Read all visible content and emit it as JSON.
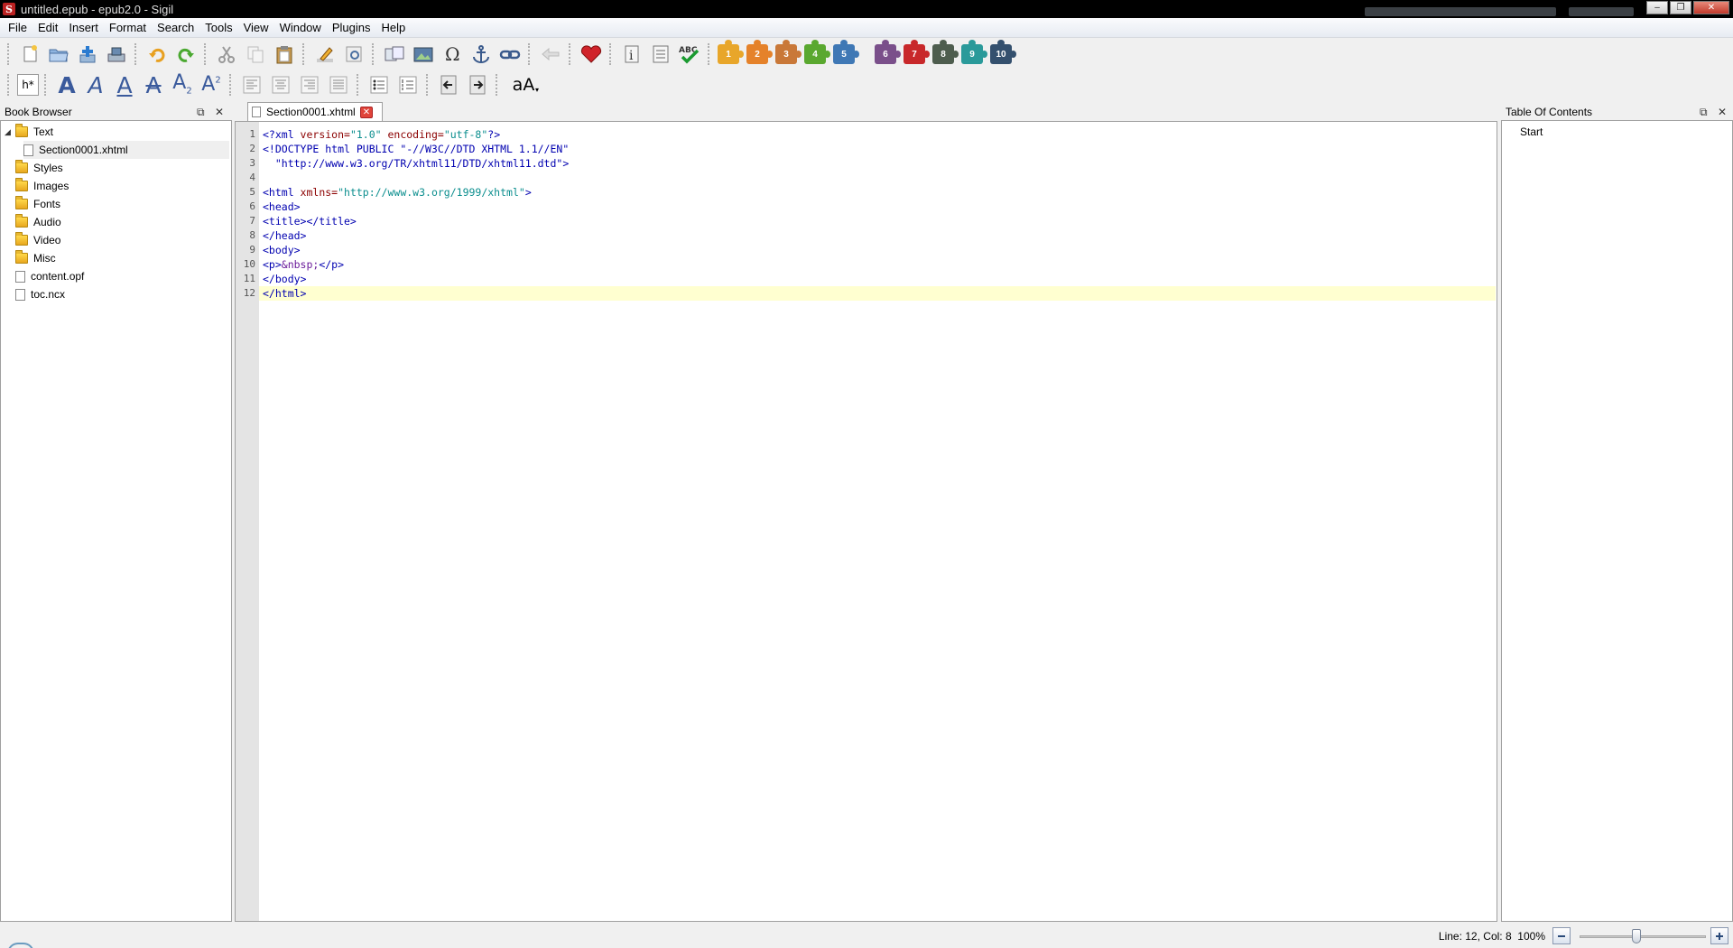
{
  "window": {
    "title": "untitled.epub - epub2.0 - Sigil",
    "logo_letter": "S",
    "minimize_glyph": "–",
    "restore_glyph": "❐",
    "close_glyph": "✕"
  },
  "menu": [
    "File",
    "Edit",
    "Insert",
    "Format",
    "Search",
    "Tools",
    "View",
    "Window",
    "Plugins",
    "Help"
  ],
  "toolbar2": {
    "heading_label": "h*",
    "font_a": "A",
    "subscript_base": "A",
    "subscript_mark": "2",
    "superscript_base": "A",
    "superscript_mark": "2",
    "case_label": "aA"
  },
  "plugins": [
    {
      "label": "1",
      "color": "#e8a62a"
    },
    {
      "label": "2",
      "color": "#e5822a"
    },
    {
      "label": "3",
      "color": "#c97838"
    },
    {
      "label": "4",
      "color": "#5aa82f"
    },
    {
      "label": "5",
      "color": "#3f78b5"
    },
    {
      "label": "6",
      "color": "#7a4f8a"
    },
    {
      "label": "7",
      "color": "#c8282a"
    },
    {
      "label": "8",
      "color": "#4e5d4e"
    },
    {
      "label": "9",
      "color": "#2a9a9a"
    },
    {
      "label": "10",
      "color": "#34506e"
    }
  ],
  "book_browser": {
    "title": "Book Browser",
    "float_glyph": "⧉",
    "close_glyph": "✕",
    "expand_glyph": "◢",
    "items": [
      {
        "label": "Text",
        "type": "folder",
        "expanded": true
      },
      {
        "label": "Section0001.xhtml",
        "type": "file",
        "selected": true
      },
      {
        "label": "Styles",
        "type": "folder"
      },
      {
        "label": "Images",
        "type": "folder"
      },
      {
        "label": "Fonts",
        "type": "folder"
      },
      {
        "label": "Audio",
        "type": "folder"
      },
      {
        "label": "Video",
        "type": "folder"
      },
      {
        "label": "Misc",
        "type": "folder"
      },
      {
        "label": "content.opf",
        "type": "file"
      },
      {
        "label": "toc.ncx",
        "type": "file"
      }
    ]
  },
  "editor": {
    "tab_label": "Section0001.xhtml",
    "tab_close_glyph": "✕",
    "line_numbers": [
      "1",
      "2",
      "3",
      "4",
      "5",
      "6",
      "7",
      "8",
      "9",
      "10",
      "11",
      "12"
    ],
    "current_line": 12,
    "code": {
      "l1_a": "<?xml ",
      "l1_b": "version=",
      "l1_c": "\"1.0\"",
      "l1_d": " encoding=",
      "l1_e": "\"utf-8\"",
      "l1_f": "?>",
      "l2": "<!DOCTYPE html PUBLIC \"-//W3C//DTD XHTML 1.1//EN\"",
      "l3": "  \"http://www.w3.org/TR/xhtml11/DTD/xhtml11.dtd\">",
      "l5_a": "<html ",
      "l5_b": "xmlns=",
      "l5_c": "\"http://www.w3.org/1999/xhtml\"",
      "l5_d": ">",
      "l6": "<head>",
      "l7": "<title></title>",
      "l8": "</head>",
      "l9": "<body>",
      "l10_a": "<p>",
      "l10_b": "&nbsp;",
      "l10_c": "</p>",
      "l11": "</body>",
      "l12": "</html>"
    }
  },
  "toc": {
    "title": "Table Of Contents",
    "float_glyph": "⧉",
    "close_glyph": "✕",
    "items": [
      "Start"
    ]
  },
  "status": {
    "position": "Line: 12, Col: 8",
    "zoom": "100%",
    "zoom_level_fraction": 0.45
  }
}
